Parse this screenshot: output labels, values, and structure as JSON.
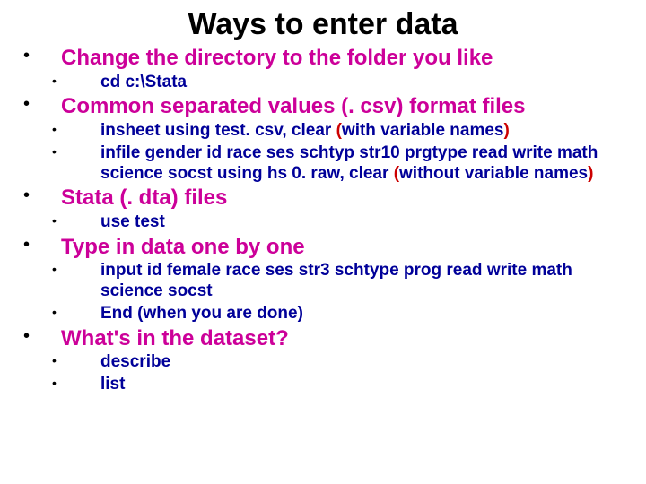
{
  "title": "Ways to enter data",
  "sections": [
    {
      "heading": "Change the directory to the folder you like",
      "items": [
        {
          "runs": [
            {
              "t": "cd c:\\Stata"
            }
          ]
        }
      ]
    },
    {
      "heading": "Common separated values (. csv) format files",
      "items": [
        {
          "runs": [
            {
              "t": "insheet using test. csv, clear "
            },
            {
              "t": "(",
              "c": "paren-red"
            },
            {
              "t": "with variable names"
            },
            {
              "t": ")",
              "c": "paren-red"
            }
          ]
        },
        {
          "runs": [
            {
              "t": "infile gender id race ses schtyp str10 prgtype read write math science socst using hs 0. raw, clear "
            },
            {
              "t": "(",
              "c": "paren-red"
            },
            {
              "t": "without variable names"
            },
            {
              "t": ")",
              "c": "paren-red"
            }
          ]
        }
      ]
    },
    {
      "heading": "Stata (. dta) files",
      "items": [
        {
          "runs": [
            {
              "t": "use test"
            }
          ]
        }
      ]
    },
    {
      "heading": "Type in data one by one",
      "items": [
        {
          "runs": [
            {
              "t": "input id female race ses str3 schtype prog read write math science socst"
            }
          ]
        },
        {
          "runs": [
            {
              "t": "End (when you are done)"
            }
          ]
        }
      ]
    },
    {
      "heading": "What's in the dataset?",
      "items": [
        {
          "runs": [
            {
              "t": "describe"
            }
          ]
        },
        {
          "runs": [
            {
              "t": "list"
            }
          ]
        }
      ]
    }
  ]
}
